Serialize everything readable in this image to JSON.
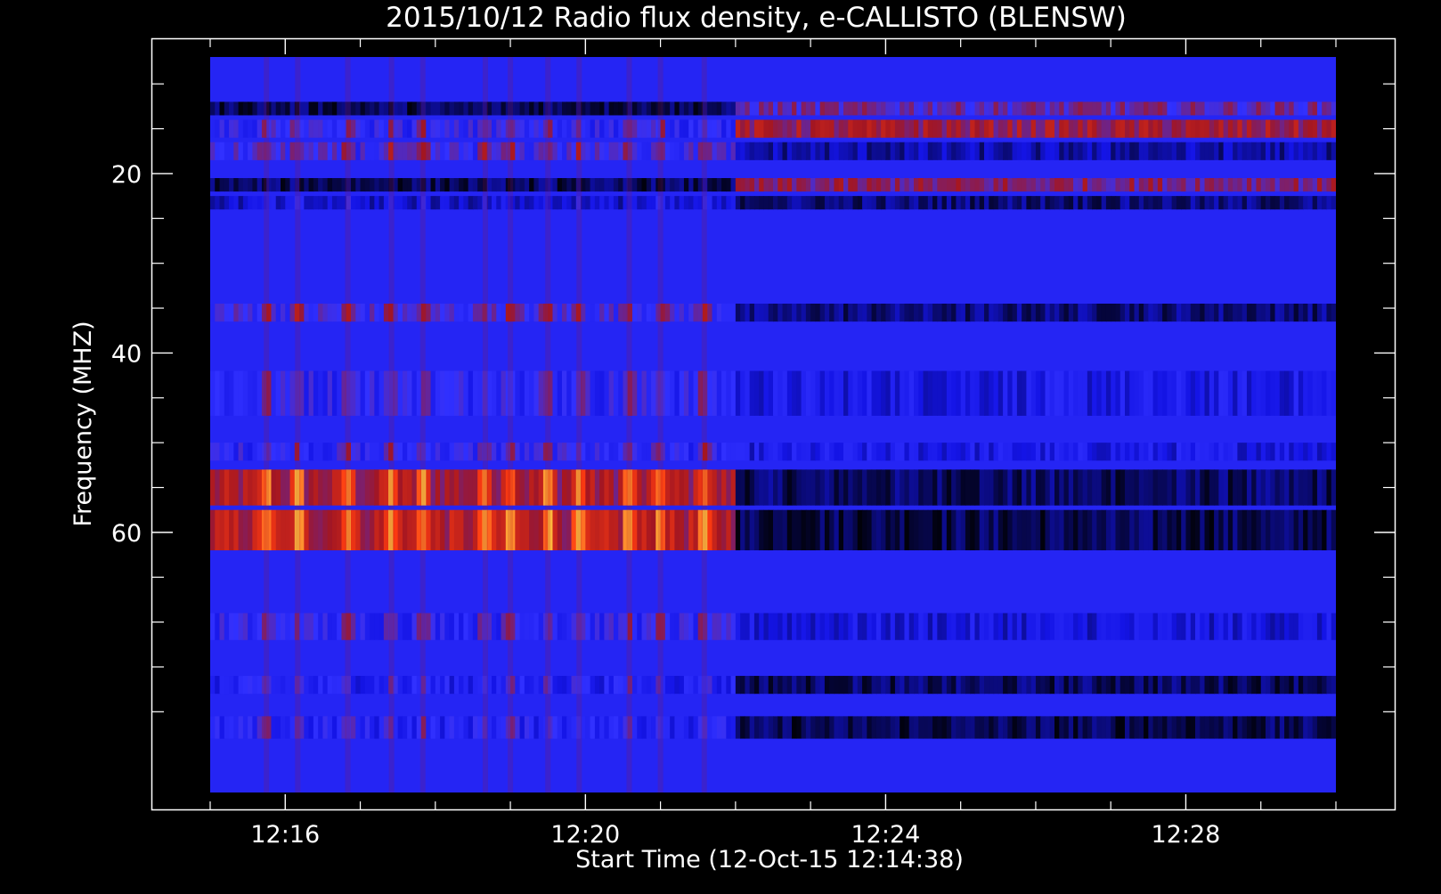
{
  "chart_data": {
    "type": "heatmap",
    "title": "2015/10/12  Radio flux density, e-CALLISTO (BLENSW)",
    "xlabel": "Start Time (12-Oct-15 12:14:38)",
    "ylabel": "Frequency (MHZ)",
    "x_unit": "minutes",
    "xlim": [
      "12:15:00",
      "12:30:00"
    ],
    "ylim": [
      89,
      7
    ],
    "y_inverted": true,
    "x_ticks": [
      {
        "value": "12:16",
        "label": "12:16"
      },
      {
        "value": "12:20",
        "label": "12:20"
      },
      {
        "value": "12:24",
        "label": "12:24"
      },
      {
        "value": "12:28",
        "label": "12:28"
      }
    ],
    "x_minor_ticks": [
      "12:15",
      "12:17",
      "12:18",
      "12:19",
      "12:21",
      "12:22",
      "12:23",
      "12:25",
      "12:26",
      "12:27",
      "12:29",
      "12:30"
    ],
    "y_ticks": [
      {
        "value": 20,
        "label": "20"
      },
      {
        "value": 40,
        "label": "40"
      },
      {
        "value": 60,
        "label": "60"
      }
    ],
    "y_minor_ticks": [
      10,
      15,
      25,
      30,
      35,
      45,
      50,
      55,
      65,
      70,
      75,
      80
    ],
    "colormap": [
      "#000000",
      "#1414e6",
      "#3131ff",
      "#a31622",
      "#ff3b10",
      "#ffc040"
    ],
    "burst_period": [
      "12:15:00",
      "12:22:00"
    ],
    "burst_columns": [
      "12:15:45",
      "12:16:10",
      "12:16:50",
      "12:17:25",
      "12:17:50",
      "12:18:40",
      "12:19:00",
      "12:19:30",
      "12:19:55",
      "12:20:35",
      "12:21:00",
      "12:21:35"
    ],
    "bands": [
      {
        "freq_low": 53,
        "freq_high": 57,
        "early_level": 0.88,
        "late_level": 0.12
      },
      {
        "freq_low": 57.5,
        "freq_high": 62,
        "early_level": 0.92,
        "late_level": 0.1
      },
      {
        "freq_low": 50,
        "freq_high": 52,
        "early_level": 0.55,
        "late_level": 0.3
      },
      {
        "freq_low": 42,
        "freq_high": 47,
        "early_level": 0.55,
        "late_level": 0.3
      },
      {
        "freq_low": 34.5,
        "freq_high": 36.5,
        "early_level": 0.62,
        "late_level": 0.15
      },
      {
        "freq_low": 69,
        "freq_high": 72,
        "early_level": 0.55,
        "late_level": 0.28
      },
      {
        "freq_low": 76,
        "freq_high": 78,
        "early_level": 0.48,
        "late_level": 0.12
      },
      {
        "freq_low": 80.5,
        "freq_high": 83,
        "early_level": 0.5,
        "late_level": 0.1
      },
      {
        "freq_low": 12,
        "freq_high": 13.5,
        "early_level": 0.15,
        "late_level": 0.5
      },
      {
        "freq_low": 14,
        "freq_high": 16,
        "early_level": 0.55,
        "late_level": 0.6
      },
      {
        "freq_low": 16.5,
        "freq_high": 18.5,
        "early_level": 0.6,
        "late_level": 0.2
      },
      {
        "freq_low": 20.5,
        "freq_high": 22,
        "early_level": 0.15,
        "late_level": 0.55
      },
      {
        "freq_low": 22.5,
        "freq_high": 24,
        "early_level": 0.35,
        "late_level": 0.15
      }
    ],
    "grid": false,
    "legend": "none"
  }
}
